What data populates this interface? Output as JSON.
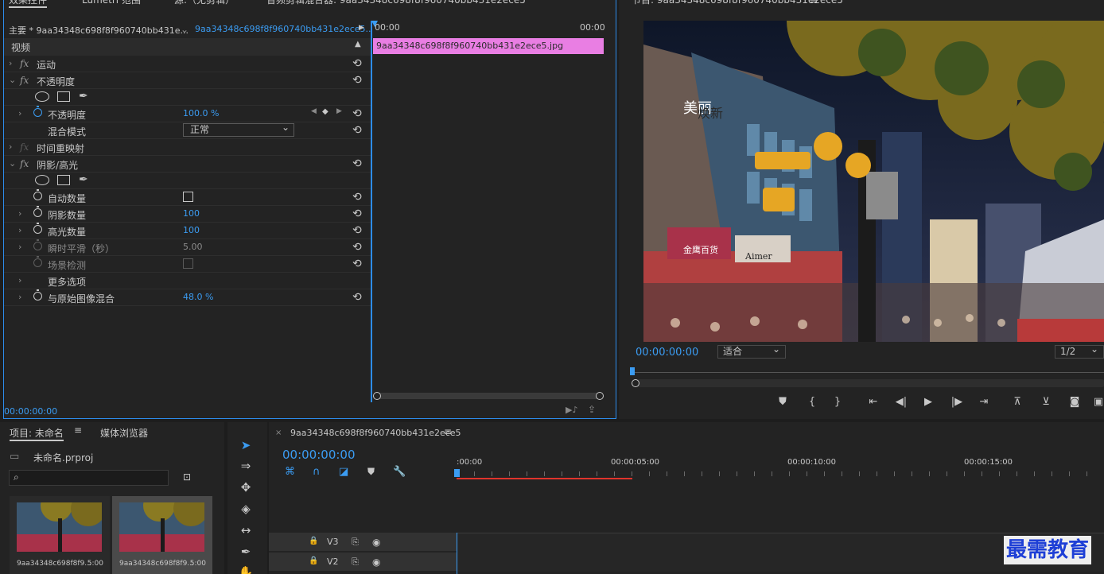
{
  "top_tabs": {
    "effect_controls": "效果控件",
    "lumetri_scopes": "Lumetri 范围",
    "source": "源:（无剪辑）",
    "audio_mixer": "音频剪辑混合器: 9aa34348c698f8f960740bb431e2ece5"
  },
  "effect_controls": {
    "master_clip": "主要 * 9aa34348c698f8f960740bb431e...",
    "sequence_clip": "9aa34348c698f8f960740bb431e2ece5...",
    "time_start": "00:00",
    "time_end": "00:00",
    "section_label": "视频",
    "clip_name": "9aa34348c698f8f960740bb431e2ece5.jpg",
    "current_time": "00:00:00:00",
    "rows": {
      "motion": "运动",
      "opacity": "不透明度",
      "opacity_prop": "不透明度",
      "opacity_value": "100.0 %",
      "blend_mode": "混合模式",
      "blend_value": "正常",
      "time_remap": "时间重映射",
      "shadow_highlight": "阴影/高光",
      "auto_amount": "自动数量",
      "shadow_amount": "阴影数量",
      "shadow_value": "100",
      "highlight_amount": "高光数量",
      "highlight_value": "100",
      "temporal_smoothing": "瞬时平滑（秒）",
      "temporal_value": "5.00",
      "scene_detect": "场景检测",
      "more_options": "更多选项",
      "blend_original": "与原始图像混合",
      "blend_original_value": "48.0 %"
    }
  },
  "program_monitor": {
    "title": "节目: 9aa34348c698f8f960740bb431e2ece5",
    "timecode": "00:00:00:00",
    "fit": "适合",
    "resolution": "1/2",
    "image_sign_1": "美丽",
    "image_sign_2": "焕新",
    "image_sign_3": "金鹰百货",
    "image_sign_4": "Aimer"
  },
  "project": {
    "tab_label": "项目: 未命名",
    "media_browser": "媒体浏览器",
    "file_name": "未命名.prproj",
    "search_placeholder": "",
    "items": [
      {
        "name": "9aa34348c698f8f9...",
        "duration": "5:00"
      },
      {
        "name": "9aa34348c698f8f9...",
        "duration": "5:00"
      }
    ]
  },
  "timeline": {
    "sequence_name": "9aa34348c698f8f960740bb431e2ece5",
    "timecode": "00:00:00:00",
    "ruler": [
      ":00:00",
      "00:00:05:00",
      "00:00:10:00",
      "00:00:15:00"
    ],
    "tracks": [
      {
        "name": "V3"
      },
      {
        "name": "V2"
      }
    ]
  },
  "watermark": "最需教育",
  "colors": {
    "accent_blue": "#2d8ceb",
    "clip_pink": "#e97ee3",
    "work_area_red": "#e0342c",
    "watermark_blue": "#1e3fd6"
  }
}
